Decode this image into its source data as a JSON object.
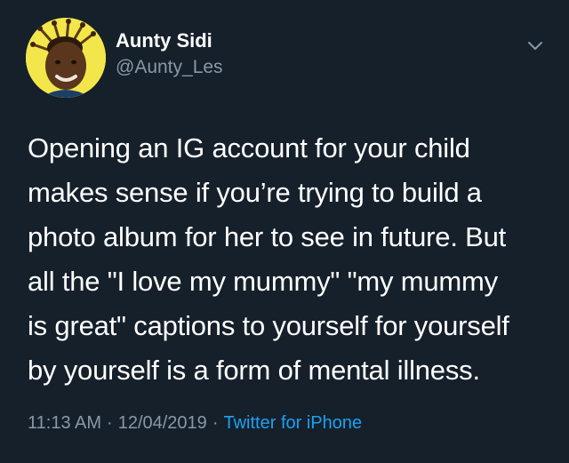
{
  "tweet": {
    "author": {
      "display_name": "Aunty Sidi",
      "handle": "@Aunty_Les"
    },
    "text_lines": [
      "Opening an IG account for your child",
      "makes sense if you’re trying to build a",
      "photo album for her to see in future. But",
      "all the \"I love my mummy\" \"my mummy",
      "is great\" captions to yourself for yourself",
      "by yourself is a form of mental illness."
    ],
    "time": "11:13 AM",
    "date": "12/04/2019",
    "separator": "·",
    "source": "Twitter for iPhone"
  },
  "icons": {
    "avatar": "profile-photo",
    "menu": "chevron-down-icon"
  },
  "colors": {
    "background": "#15202b",
    "text": "#ffffff",
    "secondary_text": "#8899a6",
    "link": "#1da1f2",
    "avatar_bg": "#f3e64a"
  }
}
